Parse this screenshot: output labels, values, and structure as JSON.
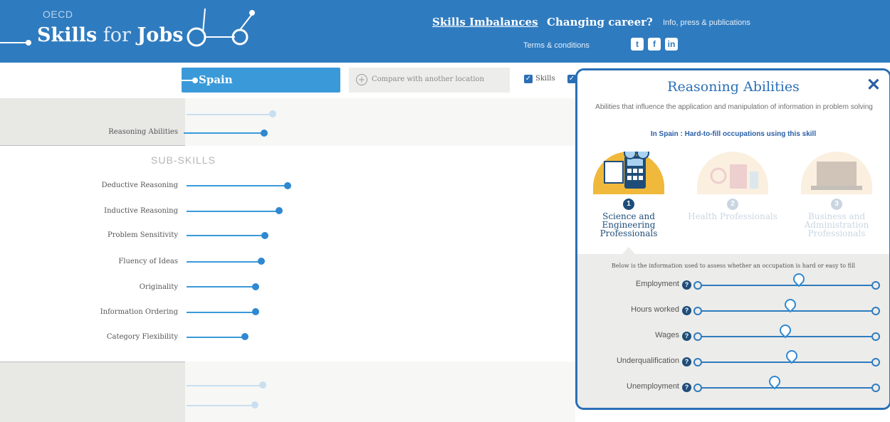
{
  "header": {
    "org": "OECD",
    "brand_word1": "Skills",
    "brand_link": "for",
    "brand_word2": "Jobs",
    "nav": {
      "skills_imbalances": "Skills Imbalances",
      "changing_career": "Changing career?",
      "info": "Info, press & publications",
      "terms": "Terms & conditions"
    },
    "social": [
      "twitter-icon",
      "facebook-icon",
      "linkedin-icon"
    ]
  },
  "location": {
    "selected": "Spain",
    "compare_label": "Compare with another location",
    "filter_label": "Skills"
  },
  "chart": {
    "main_label": "Reasoning Abilities",
    "sub_title": "SUB-SKILLS",
    "sub_skills": [
      "Deductive Reasoning",
      "Inductive Reasoning",
      "Problem Sensitivity",
      "Fluency of Ideas",
      "Originality",
      "Information Ordering",
      "Category Flexibility"
    ]
  },
  "panel": {
    "title": "Reasoning Abilities",
    "close": "✕",
    "description": "Abilities that influence the application and manipulation of information in problem solving",
    "spain_line": "In Spain : Hard-to-fill occupations using this skill",
    "occupations": [
      {
        "num": "1",
        "name": "Science and Engineering Professionals",
        "active": true
      },
      {
        "num": "2",
        "name": "Health Professionals",
        "active": false
      },
      {
        "num": "3",
        "name": "Business and Administration Professionals",
        "active": false
      }
    ],
    "note": "Below is the information used to assess whether an occupation is hard or easy to fill",
    "indicators": [
      {
        "label": "Employment",
        "level": 0.57
      },
      {
        "label": "Hours worked",
        "level": 0.52
      },
      {
        "label": "Wages",
        "level": 0.49
      },
      {
        "label": "Underqualification",
        "level": 0.53
      },
      {
        "label": "Unemployment",
        "level": 0.43
      }
    ]
  }
}
